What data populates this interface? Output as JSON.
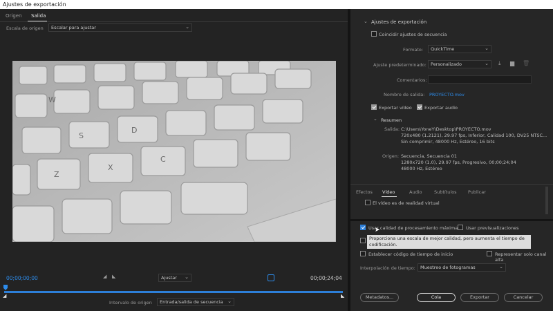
{
  "window": {
    "title": "Ajustes de exportación"
  },
  "left": {
    "tabs": [
      "Origen",
      "Salida"
    ],
    "source_scale_label": "Escala de origen",
    "source_scale_value": "Escalar para ajustar",
    "timecode_start": "00;00;00;00",
    "timecode_end": "00;00;24;04",
    "fit_label": "Ajustar",
    "source_range_label": "Intervalo de origen",
    "source_range_value": "Entrada/salida de secuencia"
  },
  "settings": {
    "header": "Ajustes de exportación",
    "match_sequence": "Coincidir ajustes de secuencia",
    "format_label": "Formato:",
    "format_value": "QuickTime",
    "preset_label": "Ajuste predeterminado:",
    "preset_value": "Personalizado",
    "comments_label": "Comentarios:",
    "output_name_label": "Nombre de salida:",
    "output_name_value": "PROYECTO.mov",
    "export_video": "Exportar vídeo",
    "export_audio": "Exportar audio",
    "summary_header": "Resumen",
    "output_label": "Salida:",
    "output_lines": [
      "C:\\Users\\YoneY\\Desktop\\PROYECTO.mov",
      "720x480 (1.2121), 29.97 fps, Inferior, Calidad 100, DV25 NTSC...",
      "Sin comprimir, 48000 Hz, Estéreo, 16 bits"
    ],
    "source_label": "Origen:",
    "source_lines": [
      "Secuencia, Secuencia 01",
      "1280x720 (1.0), 29.97 fps, Progresivo, 00;00;24;04",
      "48000 Hz, Estéreo"
    ]
  },
  "bottom_tabs": [
    "Efectos",
    "Vídeo",
    "Audio",
    "Subtítulos",
    "Publicar"
  ],
  "vr_video": "El vídeo es de realidad virtual",
  "options": {
    "max_quality": "Usar calidad de procesamiento máxima",
    "use_previews": "Usar previsualizaciones",
    "tooltip": "Proporciona una escala de mejor calidad, pero aumenta el tiempo de codificación.",
    "start_timecode": "Establecer código de tiempo de inicio",
    "alpha_only": "Representar solo canal alfa",
    "interp_label": "Interpolación de tiempo:",
    "interp_value": "Muestreo de fotogramas"
  },
  "buttons": {
    "metadata": "Metadatos...",
    "queue": "Cola",
    "export": "Exportar",
    "cancel": "Cancelar"
  }
}
